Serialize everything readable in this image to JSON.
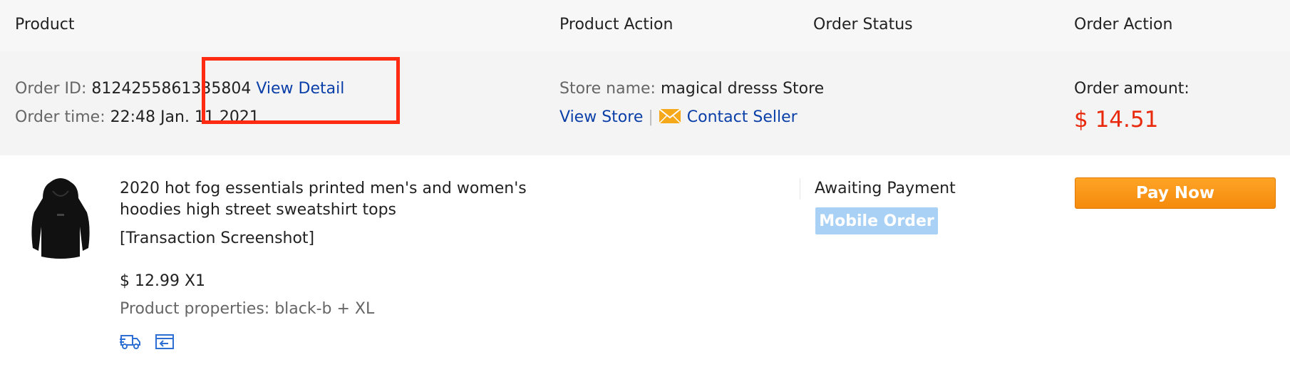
{
  "header": {
    "product": "Product",
    "product_action": "Product Action",
    "order_status": "Order Status",
    "order_action": "Order Action"
  },
  "order": {
    "id_label": "Order ID:",
    "id_value": "8124255861335804",
    "view_detail": "View Detail",
    "time_label": "Order time:",
    "time_value": "22:48 Jan. 11 2021",
    "store_label": "Store name:",
    "store_value": "magical dresss Store",
    "view_store": "View Store",
    "separator": "|",
    "contact_seller": "Contact Seller",
    "amount_label": "Order amount:",
    "amount_value": "$ 14.51"
  },
  "product": {
    "title_line1": "2020 hot fog essentials printed men's and women's",
    "title_line2": "hoodies high street sweatshirt tops",
    "transaction_screenshot": "[Transaction Screenshot]",
    "price_qty": "$ 12.99 X1",
    "properties": "Product properties: black-b + XL",
    "image_icon": "black-hoodie-image",
    "icons": [
      "delivery-truck-icon",
      "return-box-icon"
    ]
  },
  "status": {
    "text": "Awaiting Payment",
    "badge": "Mobile Order"
  },
  "actions": {
    "pay_now": "Pay Now"
  },
  "colors": {
    "link": "#0b3fa8",
    "amount": "#e8290b",
    "highlight": "#ff2a12",
    "pay_button": "#f48a0c",
    "badge": "#a9d0f5"
  }
}
